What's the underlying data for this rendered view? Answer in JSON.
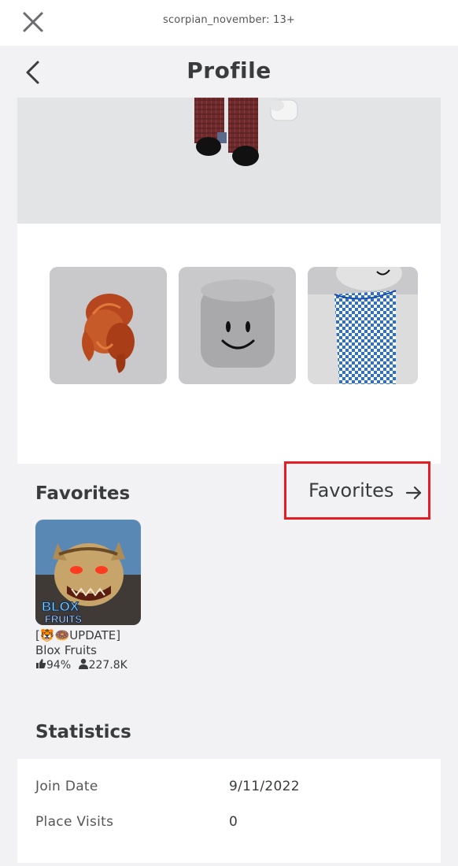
{
  "topbar": {
    "account_label": "scorpian_november: 13+"
  },
  "header": {
    "title": "Profile"
  },
  "icons": {
    "close": "close-icon",
    "back": "chevron-left-icon",
    "arrow": "arrow-right-icon",
    "thumbs_up": "thumbs-up-icon",
    "player": "player-icon"
  },
  "avatar_items": [
    {
      "name": "orange-hair-accessory"
    },
    {
      "name": "smiley-head"
    },
    {
      "name": "blue-checkered-shirt"
    }
  ],
  "favorites": {
    "heading": "Favorites",
    "link_label": "Favorites",
    "games": [
      {
        "title_line1": "[🐯🍩UPDATE]",
        "title_line2": "Blox Fruits",
        "rating": "94%",
        "players": "227.8K",
        "thumb_text_1": "BLOX",
        "thumb_text_2": "FRUITS"
      }
    ]
  },
  "statistics": {
    "heading": "Statistics",
    "rows": [
      {
        "label": "Join Date",
        "value": "9/11/2022"
      },
      {
        "label": "Place Visits",
        "value": "0"
      }
    ]
  },
  "colors": {
    "highlight": "#e31e24",
    "background": "#f2f2f4",
    "text": "#393b3d"
  }
}
